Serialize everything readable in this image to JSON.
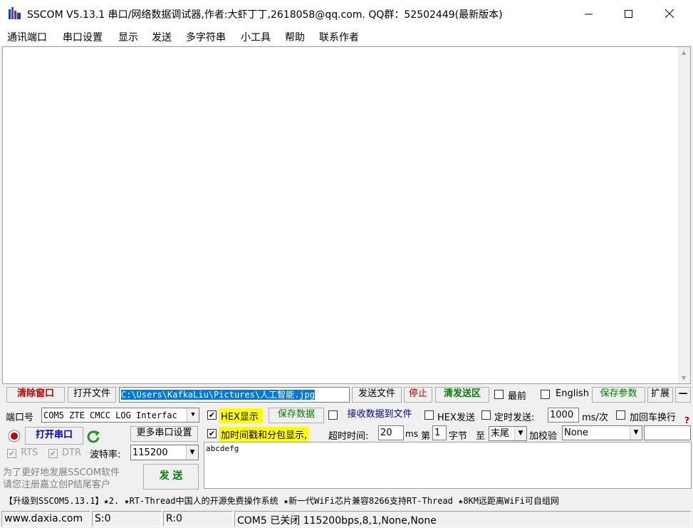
{
  "window": {
    "title": "SSCOM V5.13.1 串口/网络数据调试器,作者:大虾丁丁,2618058@qq.com. QQ群：52502449(最新版本)"
  },
  "menu": [
    "通讯端口",
    "串口设置",
    "显示",
    "发送",
    "多字符串",
    "小工具",
    "帮助",
    "联系作者"
  ],
  "toolbar": {
    "clear_window": "清除窗口",
    "open_file": "打开文件",
    "file_path": "C:\\Users\\KafkaLiu\\Pictures\\人工智能.jpg",
    "send_file": "发送文件",
    "stop": "停止",
    "clear_send": "清发送区",
    "topmost": "最前",
    "english": "English",
    "save_params": "保存参数",
    "expand": "扩展",
    "collapse": "—"
  },
  "port": {
    "label": "端口号",
    "value": "COM5 ZTE CMCC LOG Interfac",
    "open_button": "打开串口",
    "more_settings": "更多串口设置",
    "rts": "RTS",
    "dtr": "DTR",
    "baud_label": "波特率:",
    "baud_value": "115200"
  },
  "display": {
    "hex_display": "HEX显示",
    "save_data": "保存数据",
    "recv_to_file": "接收数据到文件",
    "hex_send": "HEX发送",
    "timed_send": "定时发送:",
    "interval": "1000",
    "interval_unit": "ms/次",
    "add_crlf": "加回车换行",
    "timestamp": "加时间戳和分包显示,",
    "timeout_label": "超时时间:",
    "timeout_value": "20",
    "timeout_unit": "ms",
    "byte_prefix": "第",
    "byte_index": "1",
    "byte_suffix": "字节",
    "to": "至",
    "end_option": "末尾",
    "checksum_label": "加校验",
    "checksum_value": "None"
  },
  "send": {
    "text": "abcdefg",
    "button": "发 送",
    "promo_line1": "为了更好地发展SSCOM软件",
    "promo_line2": "请您注册嘉立创P结尾客户"
  },
  "ticker": "【升级到SSCOM5.13.1】★2. ★RT-Thread中国人的开源免费操作系统 ★新一代WiFi芯片兼容8266支持RT-Thread ★8KM远距离WiFi可自组网",
  "status": {
    "website": "www.daxia.com",
    "sent": "S:0",
    "received": "R:0",
    "port_status": "COM5 已关闭  115200bps,8,1,None,None"
  }
}
